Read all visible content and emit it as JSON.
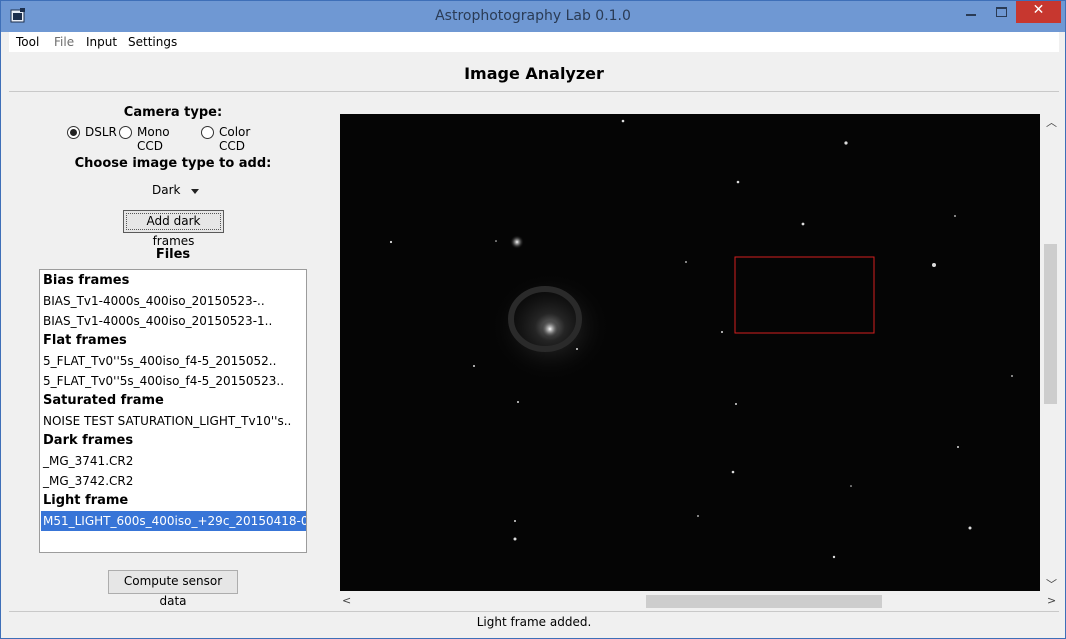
{
  "window": {
    "title": "Astrophotography Lab 0.1.0",
    "close_glyph": "✕"
  },
  "menu": {
    "items": [
      {
        "label": "Tool",
        "enabled": true
      },
      {
        "label": "File",
        "enabled": false
      },
      {
        "label": "Input",
        "enabled": true
      },
      {
        "label": "Settings",
        "enabled": true
      }
    ]
  },
  "header": {
    "title": "Image Analyzer"
  },
  "camera": {
    "label": "Camera type:",
    "options": [
      {
        "label": "DSLR",
        "checked": true
      },
      {
        "label": "Mono CCD",
        "checked": false
      },
      {
        "label": "Color CCD",
        "checked": false
      }
    ]
  },
  "image_type": {
    "label": "Choose image type to add:",
    "selected": "Dark",
    "add_button_label": "Add dark frames"
  },
  "files": {
    "label": "Files",
    "rows": [
      {
        "text": "Bias frames",
        "group": true
      },
      {
        "text": "BIAS_Tv1-4000s_400iso_20150523-..",
        "group": false
      },
      {
        "text": "BIAS_Tv1-4000s_400iso_20150523-1..",
        "group": false
      },
      {
        "text": "Flat frames",
        "group": true
      },
      {
        "text": "5_FLAT_Tv0''5s_400iso_f4-5_2015052..",
        "group": false
      },
      {
        "text": "5_FLAT_Tv0''5s_400iso_f4-5_20150523..",
        "group": false
      },
      {
        "text": "Saturated frame",
        "group": true
      },
      {
        "text": "NOISE TEST SATURATION_LIGHT_Tv10''s..",
        "group": false
      },
      {
        "text": "Dark frames",
        "group": true
      },
      {
        "text": "_MG_3741.CR2",
        "group": false
      },
      {
        "text": "_MG_3742.CR2",
        "group": false
      },
      {
        "text": "Light frame",
        "group": true
      },
      {
        "text": "M51_LIGHT_600s_400iso_+29c_20150418-0..",
        "group": false,
        "selected": true
      }
    ]
  },
  "compute_button_label": "Compute sensor data",
  "status": {
    "text": "Light frame added."
  },
  "colors": {
    "selection": "#3875d7",
    "selection_box": "#d21e1e",
    "titlebar": "#6f98d3",
    "close_button": "#c7372f"
  }
}
